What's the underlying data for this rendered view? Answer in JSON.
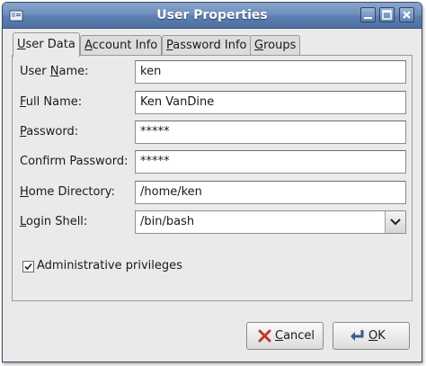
{
  "window": {
    "title": "User Properties"
  },
  "tabs": [
    {
      "label": "User Data",
      "mnemonic": "U",
      "rest": "ser Data"
    },
    {
      "label": "Account Info",
      "mnemonic": "A",
      "rest": "ccount Info"
    },
    {
      "label": "Password Info",
      "mnemonic": "P",
      "rest": "assword Info"
    },
    {
      "label": "Groups",
      "mnemonic": "G",
      "rest": "roups"
    }
  ],
  "form": {
    "user_name": {
      "pre": "User ",
      "mnemonic": "N",
      "post": "ame:",
      "value": "ken"
    },
    "full_name": {
      "pre": "",
      "mnemonic": "F",
      "post": "ull Name:",
      "value": "Ken VanDine"
    },
    "password": {
      "pre": "",
      "mnemonic": "P",
      "post": "assword:",
      "value": "*****"
    },
    "confirm_password": {
      "pre": "Conf",
      "mnemonic": "i",
      "post": "rm Password:",
      "value": "*****"
    },
    "home_directory": {
      "pre": "",
      "mnemonic": "H",
      "post": "ome Directory:",
      "value": "/home/ken"
    },
    "login_shell": {
      "pre": "",
      "mnemonic": "L",
      "post": "ogin Shell:",
      "value": "/bin/bash"
    }
  },
  "admin": {
    "label": "Administrative privileges",
    "checked": true
  },
  "buttons": {
    "cancel": {
      "mnemonic": "C",
      "rest": "ancel"
    },
    "ok": {
      "mnemonic": "O",
      "rest": "K"
    }
  },
  "colors": {
    "titlebar": "#5c7eb0",
    "window_bg": "#eaeaea",
    "cancel_icon": "#c0392b",
    "ok_icon": "#4a6fa5"
  },
  "icons": {
    "app": "user-properties-icon",
    "minimize": "minimize-icon",
    "maximize": "maximize-icon",
    "close": "close-icon",
    "combo_arrow": "chevron-down-icon",
    "check": "check-icon",
    "cancel": "cancel-x-icon",
    "ok": "ok-return-icon"
  }
}
